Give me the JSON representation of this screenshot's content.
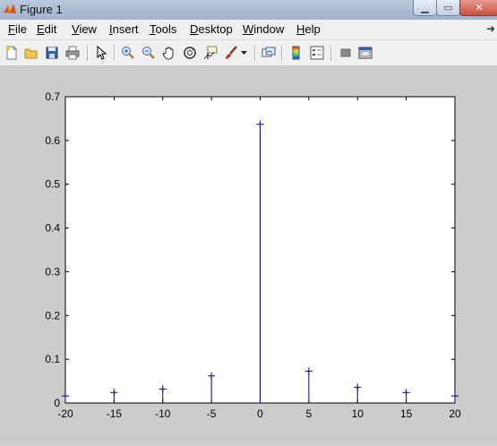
{
  "window": {
    "title": "Figure 1"
  },
  "menu": {
    "items": [
      {
        "name": "menu-file",
        "label": "File"
      },
      {
        "name": "menu-edit",
        "label": "Edit"
      },
      {
        "name": "menu-view",
        "label": "View"
      },
      {
        "name": "menu-insert",
        "label": "Insert"
      },
      {
        "name": "menu-tools",
        "label": "Tools"
      },
      {
        "name": "menu-desktop",
        "label": "Desktop"
      },
      {
        "name": "menu-window",
        "label": "Window"
      },
      {
        "name": "menu-help",
        "label": "Help"
      }
    ]
  },
  "toolbar": {
    "icons": [
      "new-figure-icon",
      "open-file-icon",
      "save-icon",
      "print-icon",
      "edit-plot-arrow-icon",
      "zoom-in-icon",
      "zoom-out-icon",
      "pan-hand-icon",
      "rotate-3d-icon",
      "data-cursor-icon",
      "brush-icon",
      "brush-dropdown-icon",
      "link-plot-icon",
      "colorbar-icon",
      "legend-icon",
      "hide-plot-tools-icon",
      "show-plot-tools-icon"
    ]
  },
  "colors": {
    "stem": "#00008b",
    "axes_bg": "#ffffff",
    "figure_bg": "#cccccc"
  },
  "chart_data": {
    "type": "stem",
    "x": [
      -20,
      -15,
      -10,
      -5,
      0,
      5,
      10,
      15,
      20
    ],
    "y": [
      0.016,
      0.024,
      0.032,
      0.062,
      0.637,
      0.073,
      0.036,
      0.024,
      0.016
    ],
    "xlim": [
      -20,
      20
    ],
    "ylim": [
      0,
      0.7
    ],
    "xticks": [
      "-20",
      "-15",
      "-10",
      "-5",
      "0",
      "5",
      "10",
      "15",
      "20"
    ],
    "yticks": [
      "0",
      "0.1",
      "0.2",
      "0.3",
      "0.4",
      "0.5",
      "0.6",
      "0.7"
    ],
    "marker": "+",
    "grid": false
  }
}
